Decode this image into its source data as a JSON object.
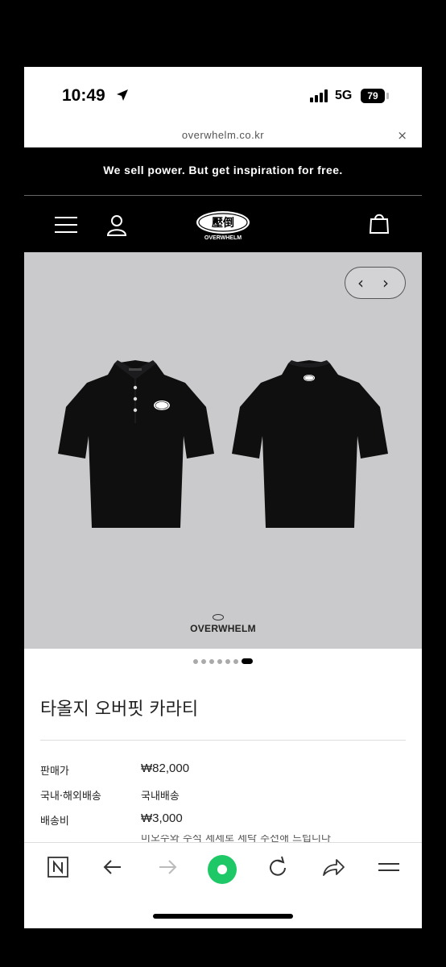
{
  "status_bar": {
    "time": "10:49",
    "network": "5G",
    "battery": "79"
  },
  "browser": {
    "url": "overwhelm.co.kr",
    "close_symbol": "×"
  },
  "banner": {
    "text": "We sell power. But get inspiration for free."
  },
  "header": {
    "logo_text": "OVERWHELM",
    "logo_kanji": "壓倒"
  },
  "gallery": {
    "brand_text": "OVERWHELM",
    "prev_symbol": "‹",
    "next_symbol": "›",
    "dots_total": 7,
    "active_dot": 7,
    "background_color": "#cac9cb"
  },
  "product": {
    "title": "타올지 오버핏 카라티",
    "details": [
      {
        "label": "판매가",
        "value": "₩82,000"
      },
      {
        "label": "국내·해외배송",
        "value": "국내배송"
      },
      {
        "label": "배송비",
        "value": "₩3,000"
      }
    ],
    "cut_off_text": "미오수와 주석 세제로 세탁 추천해 드립니다"
  },
  "toolbar": {
    "icons": [
      "naver-n-icon",
      "back-arrow-icon",
      "forward-arrow-icon",
      "naver-green-dot-icon",
      "reload-icon",
      "share-icon",
      "menu-icon"
    ],
    "accent_color": "#1ec866"
  }
}
